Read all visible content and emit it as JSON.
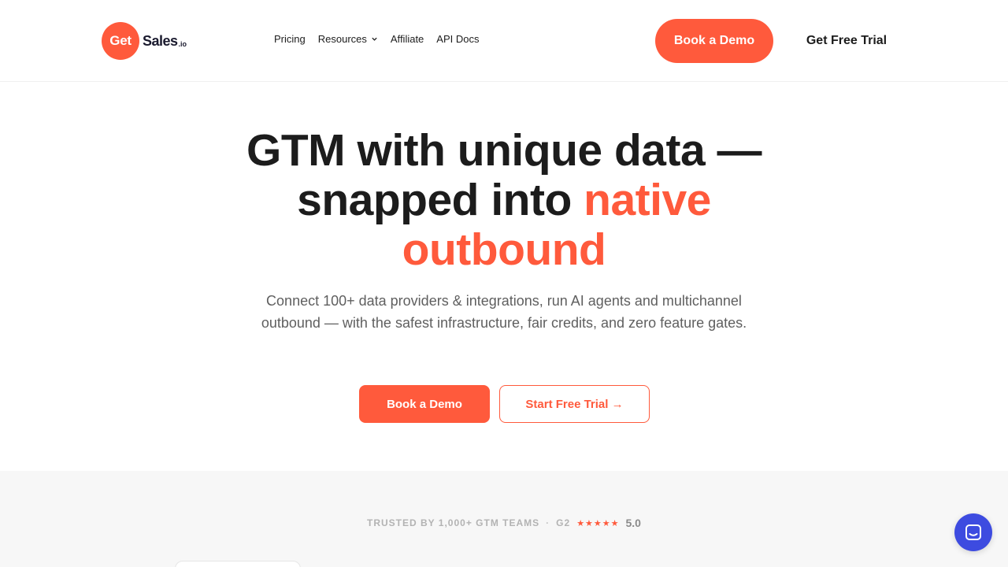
{
  "header": {
    "logo": {
      "circle_text": "Get",
      "text": "Sales",
      "suffix": ".io"
    },
    "nav": [
      {
        "label": "Pricing"
      },
      {
        "label": "Resources"
      },
      {
        "label": "Affiliate"
      },
      {
        "label": "API Docs"
      }
    ],
    "book_demo_label": "Book a Demo",
    "free_trial_label": "Get Free Trial"
  },
  "hero": {
    "title_line1": "GTM with unique data —",
    "title_line2_plain": "snapped into ",
    "title_line2_accent": "native",
    "title_line3_accent": "outbound",
    "subtitle": "Connect 100+ data providers & integrations, run AI agents and multichannel outbound — with the safest infrastructure, fair credits, and zero feature gates.",
    "book_demo_label": "Book a Demo",
    "start_trial_label": "Start Free Trial →"
  },
  "trust": {
    "text": "TRUSTED BY 1,000+ GTM TEAMS",
    "separator": "·",
    "platform": "G2",
    "stars": "★★★★★",
    "rating": "5.0"
  },
  "colors": {
    "accent": "#ff5a3c",
    "chat": "#3d4be0",
    "text": "#1c1c1c"
  },
  "icons": {
    "chevron": "chevron-down-icon",
    "chat": "chat-icon"
  }
}
